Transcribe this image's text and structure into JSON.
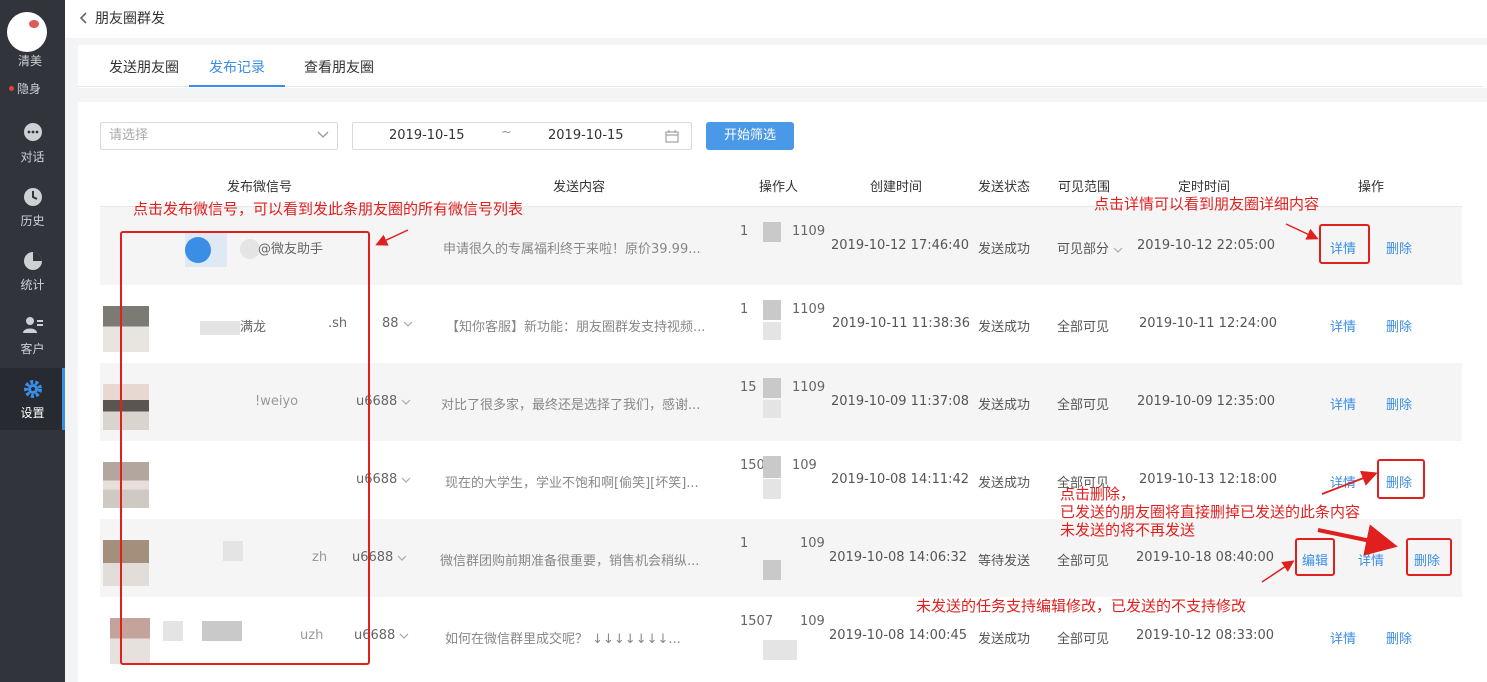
{
  "sidebar": {
    "user_name": "清美",
    "status": "隐身",
    "items": [
      {
        "label": "对话",
        "icon": "chat-icon"
      },
      {
        "label": "历史",
        "icon": "clock-icon"
      },
      {
        "label": "统计",
        "icon": "pie-chart-icon"
      },
      {
        "label": "客户",
        "icon": "contacts-icon"
      },
      {
        "label": "设置",
        "icon": "gear-icon"
      }
    ]
  },
  "header": {
    "title": "朋友圈群发"
  },
  "tabs": [
    "发送朋友圈",
    "发布记录",
    "查看朋友圈"
  ],
  "filters": {
    "select_placeholder": "请选择",
    "start_date": "2019-10-15",
    "separator": "~",
    "end_date": "2019-10-15",
    "filter_button": "开始筛选"
  },
  "table": {
    "columns": [
      "发布微信号",
      "发送内容",
      "操作人",
      "创建时间",
      "发送状态",
      "可见范围",
      "定时时间",
      "操作"
    ],
    "rows": [
      {
        "account": "@微友助手",
        "content": "申请很久的专属福利终于来啦！原价39.99...",
        "op_a": "1",
        "op_b": "1109",
        "created": "2019-10-12 17:46:40",
        "status": "发送成功",
        "scope": "可见部分",
        "scheduled": "2019-10-12 22:05:00",
        "actions": [
          "详情",
          "删除"
        ]
      },
      {
        "account": "满龙",
        "account_b": ".sh",
        "account_c": "88",
        "content": "【知你客服】新功能：朋友圈群发支持视频...",
        "op_a": "1",
        "op_b": "1109",
        "created": "2019-10-11 11:38:36",
        "status": "发送成功",
        "scope": "全部可见",
        "scheduled": "2019-10-11 12:24:00",
        "actions": [
          "详情",
          "删除"
        ]
      },
      {
        "account": "!weiyo",
        "account_b": "u6688",
        "content": "对比了很多家，最终还是选择了我们，感谢...",
        "op_a": "15",
        "op_b": "1109",
        "created": "2019-10-09 11:37:08",
        "status": "发送成功",
        "scope": "全部可见",
        "scheduled": "2019-10-09 12:35:00",
        "actions": [
          "详情",
          "删除"
        ]
      },
      {
        "account": "u6688",
        "content": "现在的大学生，学业不饱和啊[偷笑][坏笑]...",
        "op_a": "150",
        "op_b": "109",
        "created": "2019-10-08 14:11:42",
        "status": "发送成功",
        "scope": "全部可见",
        "scheduled": "2019-10-13 12:18:00",
        "actions": [
          "详情",
          "删除"
        ]
      },
      {
        "account": "zh",
        "account_b": "u6688",
        "content": "微信群团购前期准备很重要，销售机会稍纵...",
        "op_a": "1",
        "op_b": "109",
        "created": "2019-10-08 14:06:32",
        "status": "等待发送",
        "scope": "全部可见",
        "scheduled": "2019-10-18 08:40:00",
        "actions": [
          "编辑",
          "详情",
          "删除"
        ]
      },
      {
        "account": "uzh",
        "account_b": "u6688",
        "content": "如何在微信群里成交呢？ ↓↓↓↓↓↓↓...",
        "op_a": "1507",
        "op_b": "109",
        "created": "2019-10-08 14:00:45",
        "status": "发送成功",
        "scope": "全部可见",
        "scheduled": "2019-10-12 08:33:00",
        "actions": [
          "详情",
          "删除"
        ]
      }
    ]
  },
  "annotations": {
    "account_note": "点击发布微信号，可以看到发此条朋友圈的所有微信号列表",
    "detail_note": "点击详情可以看到朋友圈详细内容",
    "delete_note_1": "点击删除，",
    "delete_note_2": "已发送的朋友圈将直接删掉已发送的此条内容",
    "delete_note_3": "未发送的将不再发送",
    "edit_note": "未发送的任务支持编辑修改，已发送的不支持修改"
  },
  "colors": {
    "accent": "#3a8ee6",
    "sidebar": "#32343b",
    "annotation": "#e0201f",
    "status_dot": "#e0433f"
  }
}
